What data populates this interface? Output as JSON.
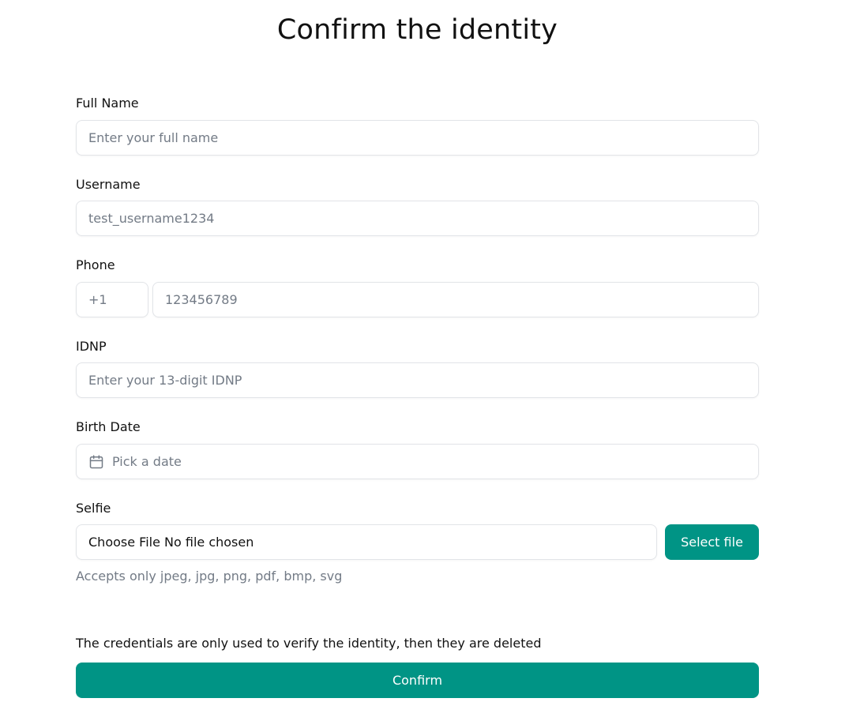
{
  "page": {
    "title": "Confirm the identity"
  },
  "form": {
    "full_name": {
      "label": "Full Name",
      "placeholder": "Enter your full name"
    },
    "username": {
      "label": "Username",
      "placeholder": "test_username1234"
    },
    "phone": {
      "label": "Phone",
      "country_code": "+1",
      "placeholder": "123456789"
    },
    "idnp": {
      "label": "IDNP",
      "placeholder": "Enter your 13-digit IDNP"
    },
    "birth_date": {
      "label": "Birth Date",
      "placeholder": "Pick a date",
      "icon": "calendar-icon"
    },
    "selfie": {
      "label": "Selfie",
      "file_input_text": "Choose File No file chosen",
      "select_button": "Select file",
      "hint": "Accepts only jpeg, jpg, png, pdf, bmp, svg"
    },
    "note": "The credentials are only used to verify the identity, then they are deleted",
    "confirm_button": "Confirm"
  },
  "colors": {
    "accent": "#009485",
    "border": "#e2e4e8",
    "placeholder": "#737b86"
  }
}
